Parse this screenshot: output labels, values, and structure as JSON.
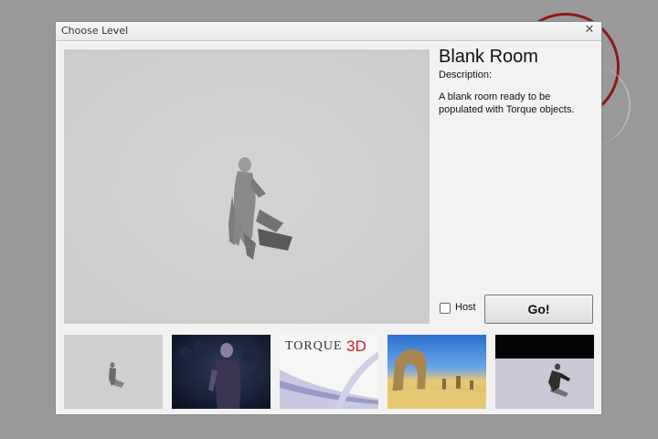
{
  "dialog": {
    "title": "Choose Level",
    "close_icon": "close-icon"
  },
  "level": {
    "name": "Blank Room",
    "description_label": "Description:",
    "description": "A blank room ready to be populated with Torque objects."
  },
  "controls": {
    "host_label": "Host",
    "host_checked": false,
    "go_label": "Go!"
  },
  "thumbnails": [
    {
      "name": "thumb-blank-room"
    },
    {
      "name": "thumb-dark-character"
    },
    {
      "name": "thumb-torque-3d-logo",
      "logo_text": "TORQUE",
      "logo_accent": "3D"
    },
    {
      "name": "thumb-desert-arch"
    },
    {
      "name": "thumb-soldier"
    }
  ],
  "colors": {
    "background": "#999999",
    "dialog": "#f2f2f2",
    "accent_ring": "#8b1a1a",
    "logo_red": "#c0202a"
  }
}
